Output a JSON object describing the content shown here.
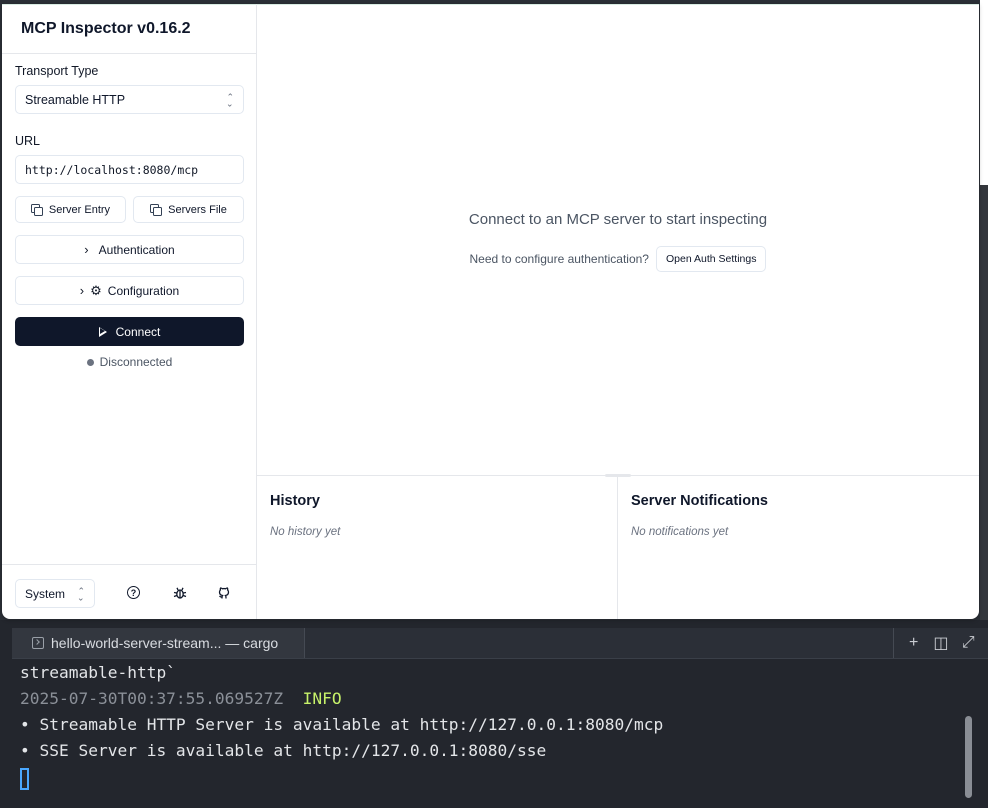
{
  "terminal": {
    "tab_title": "hello-world-server-stream... — cargo",
    "action_icons": [
      "plus-icon",
      "split-icon",
      "expand-icon"
    ],
    "lines": {
      "line1": "streamable-http`",
      "timestamp": "2025-07-30T00:37:55.069527Z",
      "level": "INFO",
      "line3": "• Streamable HTTP Server is available at http://127.0.0.1:8080/mcp",
      "line4": "• SSE Server is available at http://127.0.0.1:8080/sse"
    }
  },
  "app": {
    "title": "MCP Inspector v0.16.2",
    "sidebar": {
      "transport_label": "Transport Type",
      "transport_value": "Streamable HTTP",
      "url_label": "URL",
      "url_value": "http://localhost:8080/mcp",
      "server_entry_label": "Server Entry",
      "servers_file_label": "Servers File",
      "authentication_label": "Authentication",
      "configuration_label": "Configuration",
      "connect_label": "Connect",
      "status_text": "Disconnected",
      "theme_value": "System"
    },
    "main": {
      "empty_title": "Connect to an MCP server to start inspecting",
      "auth_prompt": "Need to configure authentication?",
      "auth_button": "Open Auth Settings",
      "history_title": "History",
      "history_empty": "No history yet",
      "notifications_title": "Server Notifications",
      "notifications_empty": "No notifications yet"
    },
    "colors": {
      "accent": "#0f172a",
      "terminal_bg": "#23262d",
      "info": "#c7f26a",
      "cursor": "#4aa8ff"
    }
  }
}
